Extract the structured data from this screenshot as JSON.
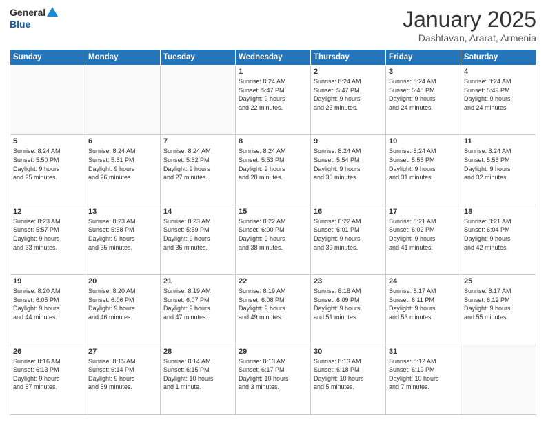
{
  "header": {
    "logo_general": "General",
    "logo_blue": "Blue",
    "month_year": "January 2025",
    "location": "Dashtavan, Ararat, Armenia"
  },
  "days_of_week": [
    "Sunday",
    "Monday",
    "Tuesday",
    "Wednesday",
    "Thursday",
    "Friday",
    "Saturday"
  ],
  "weeks": [
    [
      {
        "day": "",
        "info": ""
      },
      {
        "day": "",
        "info": ""
      },
      {
        "day": "",
        "info": ""
      },
      {
        "day": "1",
        "info": "Sunrise: 8:24 AM\nSunset: 5:47 PM\nDaylight: 9 hours\nand 22 minutes."
      },
      {
        "day": "2",
        "info": "Sunrise: 8:24 AM\nSunset: 5:47 PM\nDaylight: 9 hours\nand 23 minutes."
      },
      {
        "day": "3",
        "info": "Sunrise: 8:24 AM\nSunset: 5:48 PM\nDaylight: 9 hours\nand 24 minutes."
      },
      {
        "day": "4",
        "info": "Sunrise: 8:24 AM\nSunset: 5:49 PM\nDaylight: 9 hours\nand 24 minutes."
      }
    ],
    [
      {
        "day": "5",
        "info": "Sunrise: 8:24 AM\nSunset: 5:50 PM\nDaylight: 9 hours\nand 25 minutes."
      },
      {
        "day": "6",
        "info": "Sunrise: 8:24 AM\nSunset: 5:51 PM\nDaylight: 9 hours\nand 26 minutes."
      },
      {
        "day": "7",
        "info": "Sunrise: 8:24 AM\nSunset: 5:52 PM\nDaylight: 9 hours\nand 27 minutes."
      },
      {
        "day": "8",
        "info": "Sunrise: 8:24 AM\nSunset: 5:53 PM\nDaylight: 9 hours\nand 28 minutes."
      },
      {
        "day": "9",
        "info": "Sunrise: 8:24 AM\nSunset: 5:54 PM\nDaylight: 9 hours\nand 30 minutes."
      },
      {
        "day": "10",
        "info": "Sunrise: 8:24 AM\nSunset: 5:55 PM\nDaylight: 9 hours\nand 31 minutes."
      },
      {
        "day": "11",
        "info": "Sunrise: 8:24 AM\nSunset: 5:56 PM\nDaylight: 9 hours\nand 32 minutes."
      }
    ],
    [
      {
        "day": "12",
        "info": "Sunrise: 8:23 AM\nSunset: 5:57 PM\nDaylight: 9 hours\nand 33 minutes."
      },
      {
        "day": "13",
        "info": "Sunrise: 8:23 AM\nSunset: 5:58 PM\nDaylight: 9 hours\nand 35 minutes."
      },
      {
        "day": "14",
        "info": "Sunrise: 8:23 AM\nSunset: 5:59 PM\nDaylight: 9 hours\nand 36 minutes."
      },
      {
        "day": "15",
        "info": "Sunrise: 8:22 AM\nSunset: 6:00 PM\nDaylight: 9 hours\nand 38 minutes."
      },
      {
        "day": "16",
        "info": "Sunrise: 8:22 AM\nSunset: 6:01 PM\nDaylight: 9 hours\nand 39 minutes."
      },
      {
        "day": "17",
        "info": "Sunrise: 8:21 AM\nSunset: 6:02 PM\nDaylight: 9 hours\nand 41 minutes."
      },
      {
        "day": "18",
        "info": "Sunrise: 8:21 AM\nSunset: 6:04 PM\nDaylight: 9 hours\nand 42 minutes."
      }
    ],
    [
      {
        "day": "19",
        "info": "Sunrise: 8:20 AM\nSunset: 6:05 PM\nDaylight: 9 hours\nand 44 minutes."
      },
      {
        "day": "20",
        "info": "Sunrise: 8:20 AM\nSunset: 6:06 PM\nDaylight: 9 hours\nand 46 minutes."
      },
      {
        "day": "21",
        "info": "Sunrise: 8:19 AM\nSunset: 6:07 PM\nDaylight: 9 hours\nand 47 minutes."
      },
      {
        "day": "22",
        "info": "Sunrise: 8:19 AM\nSunset: 6:08 PM\nDaylight: 9 hours\nand 49 minutes."
      },
      {
        "day": "23",
        "info": "Sunrise: 8:18 AM\nSunset: 6:09 PM\nDaylight: 9 hours\nand 51 minutes."
      },
      {
        "day": "24",
        "info": "Sunrise: 8:17 AM\nSunset: 6:11 PM\nDaylight: 9 hours\nand 53 minutes."
      },
      {
        "day": "25",
        "info": "Sunrise: 8:17 AM\nSunset: 6:12 PM\nDaylight: 9 hours\nand 55 minutes."
      }
    ],
    [
      {
        "day": "26",
        "info": "Sunrise: 8:16 AM\nSunset: 6:13 PM\nDaylight: 9 hours\nand 57 minutes."
      },
      {
        "day": "27",
        "info": "Sunrise: 8:15 AM\nSunset: 6:14 PM\nDaylight: 9 hours\nand 59 minutes."
      },
      {
        "day": "28",
        "info": "Sunrise: 8:14 AM\nSunset: 6:15 PM\nDaylight: 10 hours\nand 1 minute."
      },
      {
        "day": "29",
        "info": "Sunrise: 8:13 AM\nSunset: 6:17 PM\nDaylight: 10 hours\nand 3 minutes."
      },
      {
        "day": "30",
        "info": "Sunrise: 8:13 AM\nSunset: 6:18 PM\nDaylight: 10 hours\nand 5 minutes."
      },
      {
        "day": "31",
        "info": "Sunrise: 8:12 AM\nSunset: 6:19 PM\nDaylight: 10 hours\nand 7 minutes."
      },
      {
        "day": "",
        "info": ""
      }
    ]
  ]
}
